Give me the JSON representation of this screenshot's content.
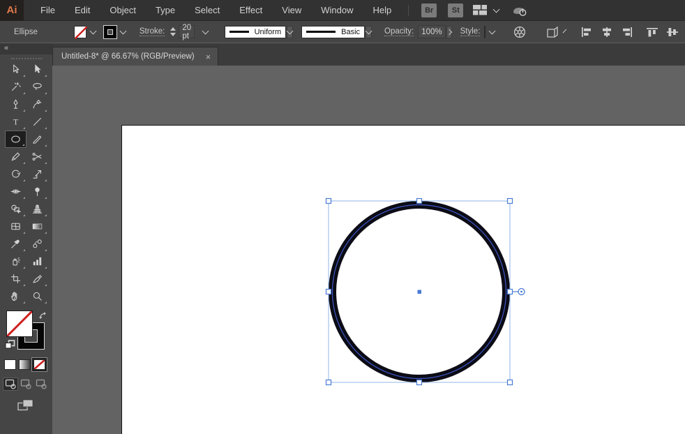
{
  "menubar": {
    "logo": "Ai",
    "items": [
      "File",
      "Edit",
      "Object",
      "Type",
      "Select",
      "Effect",
      "View",
      "Window",
      "Help"
    ],
    "bridge_label": "Br",
    "stock_label": "St",
    "icons": [
      "workspace-switcher-icon",
      "workspace-chevron-icon",
      "gpu-performance-icon"
    ]
  },
  "controlbar": {
    "tool_label": "Ellipse",
    "fill_swatch": "none",
    "stroke_swatch": "black",
    "stroke_label": "Stroke:",
    "stroke_value": "20 pt",
    "profile_value": "Uniform",
    "brush_value": "Basic",
    "opacity_label": "Opacity:",
    "opacity_value": "100%",
    "style_label": "Style:",
    "icons": [
      "recolor-artwork-icon",
      "transform-options-icon"
    ],
    "align": [
      "horizontal-align-left",
      "horizontal-align-center",
      "horizontal-align-right",
      "vertical-align-top",
      "vertical-align-center",
      "vertical-align-bottom"
    ]
  },
  "tab": {
    "title": "Untitled-8* @ 66.67% (RGB/Preview)",
    "close_label": "×"
  },
  "tools": [
    {
      "name": "selection"
    },
    {
      "name": "direct-selection"
    },
    {
      "name": "magic-wand"
    },
    {
      "name": "lasso"
    },
    {
      "name": "pen"
    },
    {
      "name": "curvature"
    },
    {
      "name": "type"
    },
    {
      "name": "line-segment"
    },
    {
      "name": "ellipse",
      "selected": true
    },
    {
      "name": "paintbrush"
    },
    {
      "name": "pencil"
    },
    {
      "name": "scissors"
    },
    {
      "name": "rotate"
    },
    {
      "name": "scale"
    },
    {
      "name": "width"
    },
    {
      "name": "puppet-warp"
    },
    {
      "name": "shape-builder"
    },
    {
      "name": "perspective-grid"
    },
    {
      "name": "mesh"
    },
    {
      "name": "gradient"
    },
    {
      "name": "eyedropper"
    },
    {
      "name": "blend"
    },
    {
      "name": "symbol-sprayer"
    },
    {
      "name": "column-graph"
    },
    {
      "name": "artboard"
    },
    {
      "name": "slice"
    },
    {
      "name": "hand"
    },
    {
      "name": "zoom"
    }
  ],
  "tool_options": {
    "fill": "none",
    "stroke": "black",
    "color_buttons": [
      "color",
      "gradient",
      "none"
    ],
    "color_selected": "none",
    "drawing_modes": [
      "draw-normal",
      "draw-behind",
      "draw-inside"
    ],
    "mode_selected": "draw-normal"
  },
  "colors": {
    "accent_orange": "#E0794A",
    "selection_blue": "#4A7BD4",
    "bbox_blue": "#8FB3E8",
    "path_blue": "#3F57C9",
    "canvas_gray": "#636363",
    "artboard_white": "#FFFFFF",
    "circle_stroke": "#0C0C16",
    "none_red": "#CC1F1F"
  }
}
